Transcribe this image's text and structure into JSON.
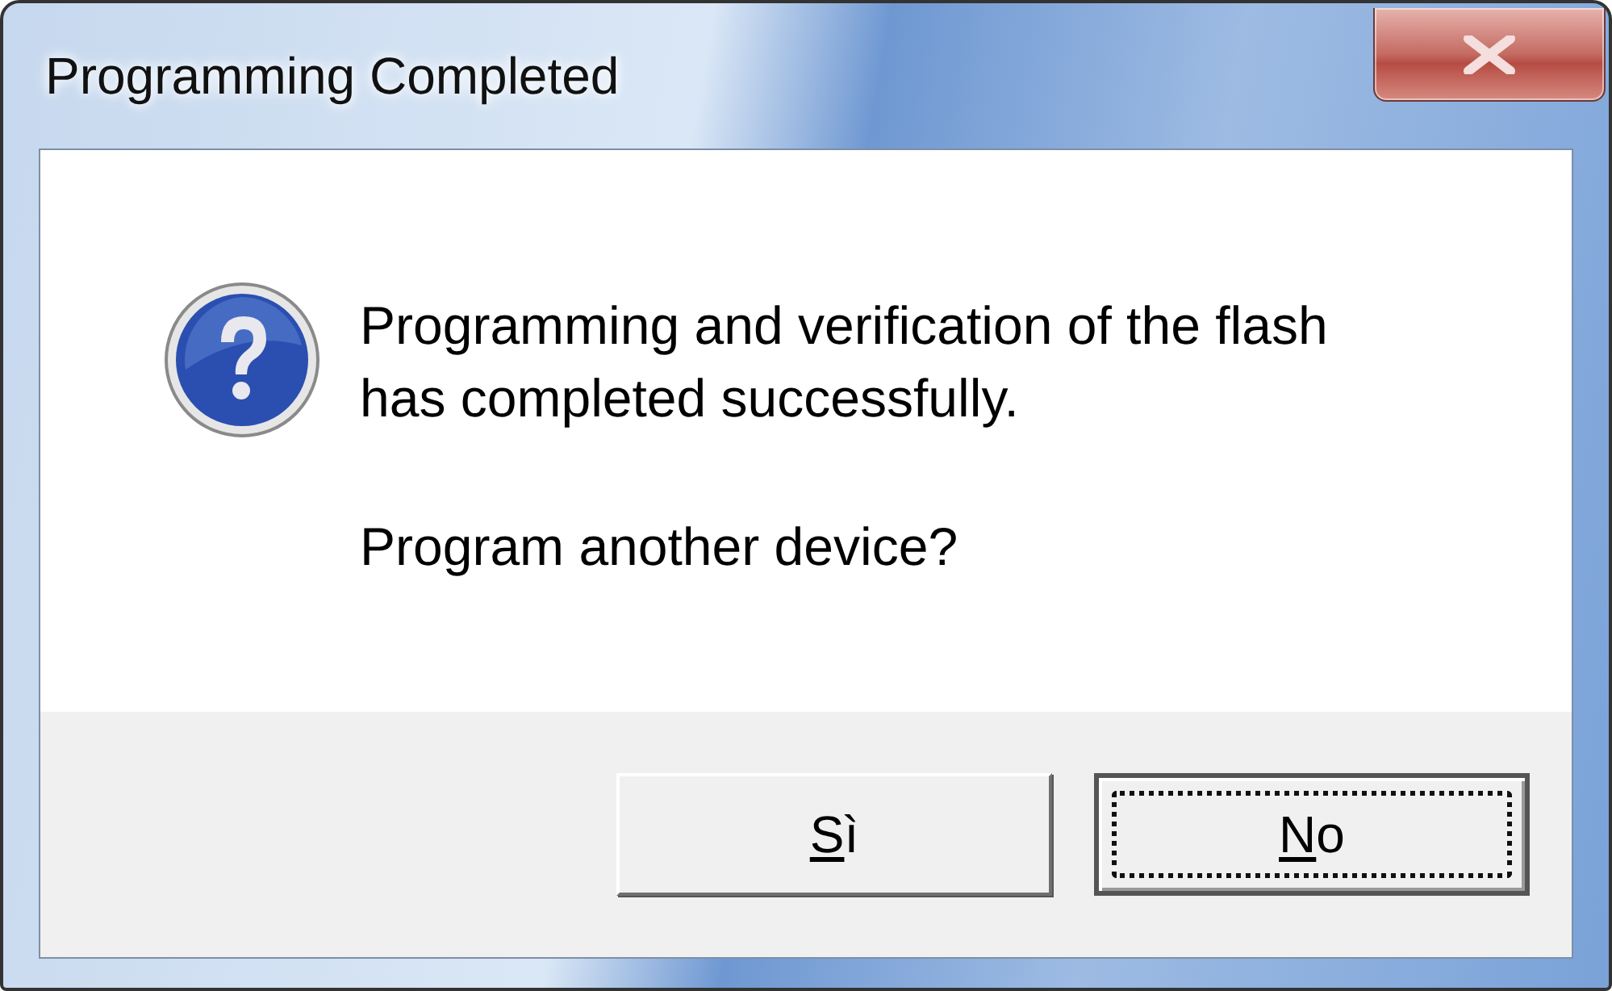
{
  "window": {
    "title": "Programming Completed"
  },
  "message": "Programming and verification of the flash has completed successfully.",
  "question": "Program another device?",
  "buttons": [
    {
      "label": "Sì",
      "focused": false
    },
    {
      "label": "No",
      "focused": true
    }
  ]
}
